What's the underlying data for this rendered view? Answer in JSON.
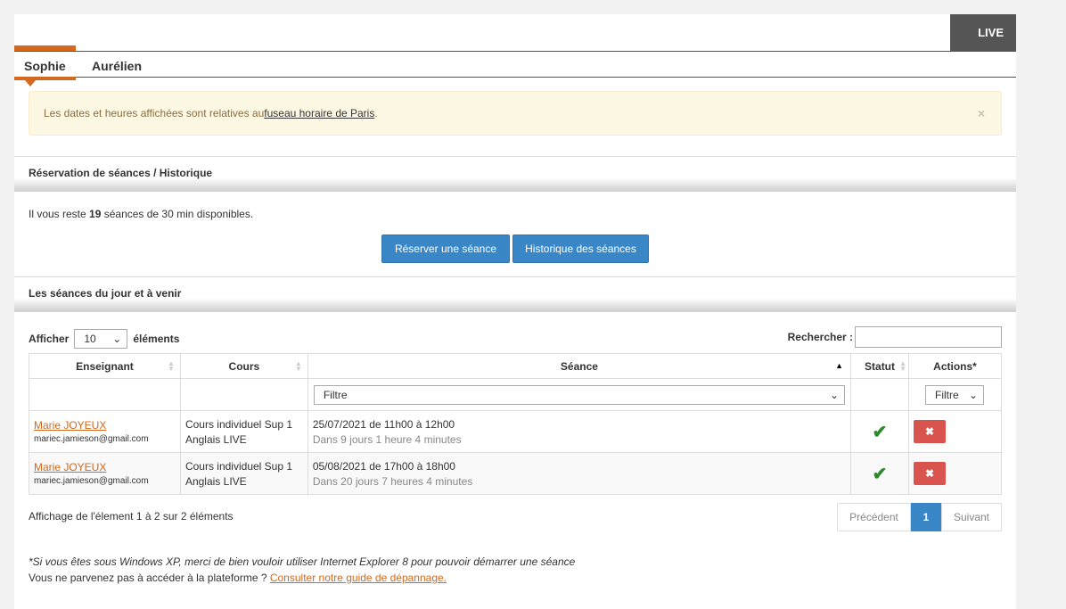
{
  "header": {
    "live_label": "LIVE"
  },
  "tabs": [
    {
      "label": "Sophie",
      "active": true
    },
    {
      "label": "Aurélien",
      "active": false
    }
  ],
  "alert": {
    "text_before": "Les dates et heures affichées sont relatives au ",
    "link": "fuseau horaire de Paris",
    "text_after": ".",
    "close": "×"
  },
  "booking": {
    "title": "Réservation de séances / Historique",
    "remaining_before": "Il vous reste ",
    "remaining_count": "19",
    "remaining_after": " séances de 30 min disponibles.",
    "reserve_button": "Réserver une séance",
    "history_button": "Historique des séances"
  },
  "sessions": {
    "title": "Les séances du jour et à venir",
    "show_label": "Afficher",
    "page_size": "10",
    "elements_label": "éléments",
    "search_label": "Rechercher :",
    "columns": [
      "Enseignant",
      "Cours",
      "Séance",
      "Statut",
      "Actions*"
    ],
    "filter_placeholder": "Filtre",
    "actions_filter": "Filtre",
    "rows": [
      {
        "teacher": "Marie JOYEUX",
        "email": "mariec.jamieson@gmail.com",
        "course_line1": "Cours individuel Sup 1",
        "course_line2": "Anglais LIVE",
        "session": "25/07/2021 de 11h00 à 12h00",
        "delay": "Dans 9 jours 1 heure 4 minutes",
        "status": "✔",
        "action": "✖"
      },
      {
        "teacher": "Marie JOYEUX",
        "email": "mariec.jamieson@gmail.com",
        "course_line1": "Cours individuel Sup 1",
        "course_line2": "Anglais LIVE",
        "session": "05/08/2021 de 17h00 à 18h00",
        "delay": "Dans 20 jours 7 heures 4 minutes",
        "status": "✔",
        "action": "✖"
      }
    ],
    "info": "Affichage de l'élement 1 à 2 sur 2 éléments",
    "pager": {
      "prev": "Précédent",
      "current": "1",
      "next": "Suivant"
    }
  },
  "footer": {
    "note": "*Si vous êtes sous Windows XP, merci de bien vouloir utiliser Internet Explorer 8 pour pouvoir démarrer une séance",
    "help_text": "Vous ne parvenez pas à accéder à la plateforme ? ",
    "help_link": "Consulter notre guide de dépannage."
  }
}
